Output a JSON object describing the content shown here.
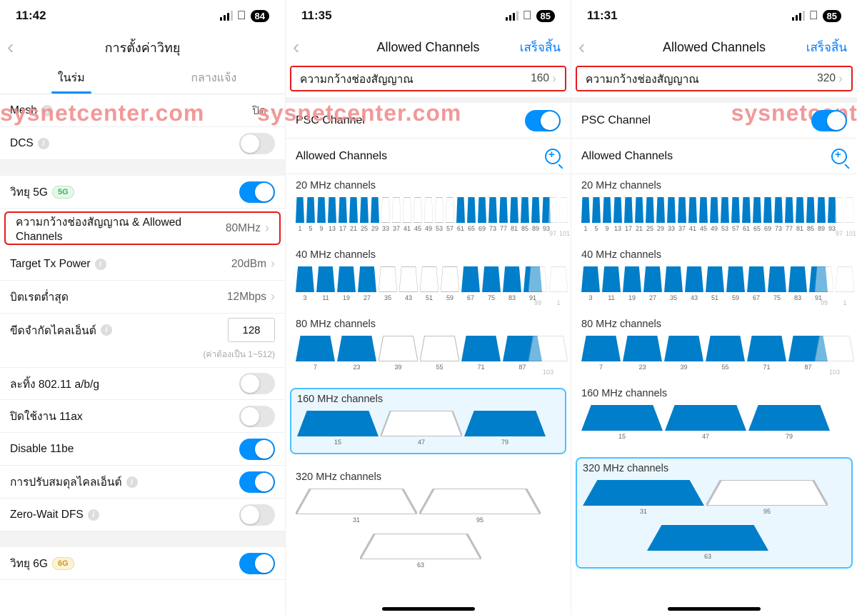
{
  "watermark": "sysnetcenter.com",
  "col1": {
    "time": "11:42",
    "battery": "84",
    "nav_title": "การตั้งค่าวิทยุ",
    "tab_indoor": "ในร่ม",
    "tab_outdoor": "กลางแจ้ง",
    "mesh_label": "Mesh",
    "mesh_val": "ปิด",
    "dcs_label": "DCS",
    "radio5g_label": "วิทยุ 5G",
    "radio5g_pill": "5G",
    "cw_label": "ความกว้างช่องสัญญาณ & Allowed Channels",
    "cw_val": "80MHz",
    "txp_label": "Target Tx Power",
    "txp_val": "20dBm",
    "bitrate_label": "บิตเรตต่ำสุด",
    "bitrate_val": "12Mbps",
    "clientlimit_label": "ขีดจำกัดไคลเอ็นต์",
    "clientlimit_val": "128",
    "clientlimit_hint": "(ค่าต้องเป็น 1~512)",
    "drop11_label": "ละทิ้ง 802.11 a/b/g",
    "dis11ax_label": "ปิดใช้งาน 11ax",
    "dis11be_label": "Disable 11be",
    "clientbal_label": "การปรับสมดุลไคลเอ็นต์",
    "zwdfs_label": "Zero-Wait DFS",
    "radio6g_label": "วิทยุ 6G",
    "radio6g_pill": "6G"
  },
  "col2": {
    "time": "11:35",
    "battery": "85",
    "nav_title": "Allowed Channels",
    "done": "เสร็จสิ้น",
    "cw_label": "ความกว้างช่องสัญญาณ",
    "cw_val": "160",
    "psc_label": "PSC Channel",
    "ac_label": "Allowed Channels",
    "ch20_title": "20 MHz channels",
    "ch20_labels": [
      "1",
      "5",
      "9",
      "13",
      "17",
      "21",
      "25",
      "29",
      "33",
      "37",
      "41",
      "45",
      "49",
      "53",
      "57",
      "61",
      "65",
      "69",
      "73",
      "77",
      "81",
      "85",
      "89",
      "93"
    ],
    "ch20_on": [
      1,
      1,
      1,
      1,
      1,
      1,
      1,
      1,
      0,
      0,
      0,
      0,
      0,
      0,
      0,
      1,
      1,
      1,
      1,
      1,
      1,
      1,
      1,
      1
    ],
    "ch20_extra": [
      "97",
      "101"
    ],
    "ch40_title": "40 MHz channels",
    "ch40_labels": [
      "3",
      "11",
      "19",
      "27",
      "35",
      "43",
      "51",
      "59",
      "67",
      "75",
      "83",
      "91"
    ],
    "ch40_on": [
      1,
      1,
      1,
      1,
      0,
      0,
      0,
      0,
      1,
      1,
      1,
      1
    ],
    "ch40_extra": [
      "99",
      "1"
    ],
    "ch80_title": "80 MHz channels",
    "ch80_labels": [
      "7",
      "23",
      "39",
      "55",
      "71",
      "87"
    ],
    "ch80_on": [
      1,
      1,
      0,
      0,
      1,
      1
    ],
    "ch80_extra": [
      "103"
    ],
    "ch160_title": "160 MHz channels",
    "ch160_labels": [
      "15",
      "47",
      "79"
    ],
    "ch160_on": [
      1,
      0,
      1
    ],
    "ch320_title": "320 MHz channels",
    "ch320_labels": [
      "31",
      "95"
    ],
    "ch320_on": [
      0,
      0
    ],
    "ch320b_labels": [
      "63"
    ],
    "ch320b_on": [
      0
    ]
  },
  "col3": {
    "time": "11:31",
    "battery": "85",
    "nav_title": "Allowed Channels",
    "done": "เสร็จสิ้น",
    "cw_label": "ความกว้างช่องสัญญาณ",
    "cw_val": "320",
    "psc_label": "PSC Channel",
    "ac_label": "Allowed Channels",
    "ch20_title": "20 MHz channels",
    "ch20_labels": [
      "1",
      "5",
      "9",
      "13",
      "17",
      "21",
      "25",
      "29",
      "33",
      "37",
      "41",
      "45",
      "49",
      "53",
      "57",
      "61",
      "65",
      "69",
      "73",
      "77",
      "81",
      "85",
      "89",
      "93"
    ],
    "ch20_on": [
      1,
      1,
      1,
      1,
      1,
      1,
      1,
      1,
      1,
      1,
      1,
      1,
      1,
      1,
      1,
      1,
      1,
      1,
      1,
      1,
      1,
      1,
      1,
      1
    ],
    "ch20_extra": [
      "97",
      "101"
    ],
    "ch40_title": "40 MHz channels",
    "ch40_labels": [
      "3",
      "11",
      "19",
      "27",
      "35",
      "43",
      "51",
      "59",
      "67",
      "75",
      "83",
      "91"
    ],
    "ch40_on": [
      1,
      1,
      1,
      1,
      1,
      1,
      1,
      1,
      1,
      1,
      1,
      1
    ],
    "ch40_extra": [
      "99",
      "1"
    ],
    "ch80_title": "80 MHz channels",
    "ch80_labels": [
      "7",
      "23",
      "39",
      "55",
      "71",
      "87"
    ],
    "ch80_on": [
      1,
      1,
      1,
      1,
      1,
      1
    ],
    "ch80_extra": [
      "103"
    ],
    "ch160_title": "160 MHz channels",
    "ch160_labels": [
      "15",
      "47",
      "79"
    ],
    "ch160_on": [
      1,
      1,
      1
    ],
    "ch320_title": "320 MHz channels",
    "ch320_labels": [
      "31",
      "95"
    ],
    "ch320_on": [
      1,
      0
    ],
    "ch320b_labels": [
      "63"
    ],
    "ch320b_on": [
      1
    ]
  }
}
